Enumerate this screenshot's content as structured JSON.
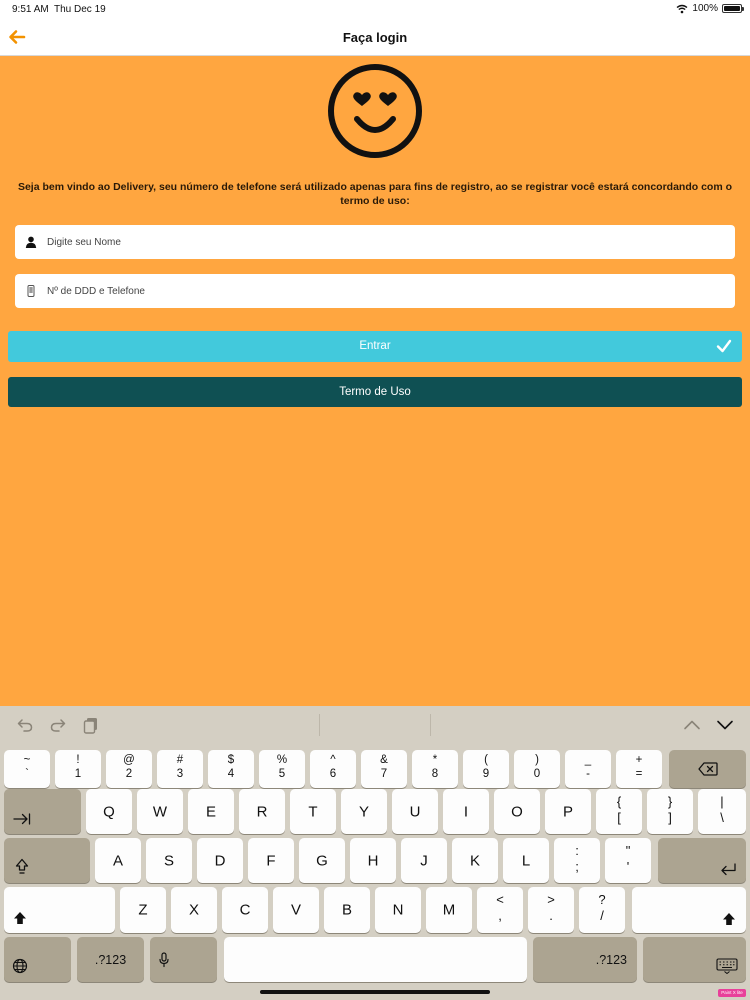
{
  "status_bar": {
    "time": "9:51 AM",
    "date": "Thu Dec 19",
    "battery": "100%"
  },
  "nav": {
    "title": "Faça login"
  },
  "welcome_text": "Seja bem vindo ao Delivery, seu número de telefone será utilizado apenas para fins de registro, ao se registrar você estará concordando com o termo de uso:",
  "form": {
    "name_placeholder": "Digite seu Nome",
    "phone_placeholder": "Nº de DDD e Telefone",
    "enter_label": "Entrar",
    "terms_label": "Termo de Uso"
  },
  "colors": {
    "background": "#ffa640",
    "enter_button": "#42c9dc",
    "terms_button": "#0f5053",
    "accent": "#f39200"
  },
  "keyboard": {
    "number_row": [
      {
        "top": "~",
        "bot": "`"
      },
      {
        "top": "!",
        "bot": "1"
      },
      {
        "top": "@",
        "bot": "2"
      },
      {
        "top": "#",
        "bot": "3"
      },
      {
        "top": "$",
        "bot": "4"
      },
      {
        "top": "%",
        "bot": "5"
      },
      {
        "top": "^",
        "bot": "6"
      },
      {
        "top": "&",
        "bot": "7"
      },
      {
        "top": "*",
        "bot": "8"
      },
      {
        "top": "(",
        "bot": "9"
      },
      {
        "top": ")",
        "bot": "0"
      },
      {
        "top": "_",
        "bot": "-"
      },
      {
        "top": "+",
        "bot": "="
      }
    ],
    "row_q": [
      "Q",
      "W",
      "E",
      "R",
      "T",
      "Y",
      "U",
      "I",
      "O",
      "P"
    ],
    "row_q_sym": [
      {
        "top": "{",
        "bot": "["
      },
      {
        "top": "}",
        "bot": "]"
      },
      {
        "top": "|",
        "bot": "\\"
      }
    ],
    "row_a": [
      "A",
      "S",
      "D",
      "F",
      "G",
      "H",
      "J",
      "K",
      "L"
    ],
    "row_a_sym": [
      {
        "top": ":",
        "bot": ";"
      },
      {
        "top": "\"",
        "bot": "'"
      }
    ],
    "row_z": [
      "Z",
      "X",
      "C",
      "V",
      "B",
      "N",
      "M"
    ],
    "row_z_sym": [
      {
        "top": "<",
        "bot": ","
      },
      {
        "top": ">",
        "bot": "."
      },
      {
        "top": "?",
        "bot": "/"
      }
    ],
    "numbers_label": ".?123"
  },
  "icons": {
    "back": "arrow-left-icon",
    "smiley": "heart-eyes-smiley-icon",
    "name_field": "user-icon",
    "phone_field": "phone-icon",
    "enter": "checkmark-icon",
    "undo": "undo-icon",
    "redo": "redo-icon",
    "paste": "paste-icon",
    "up": "chevron-up-icon",
    "down": "chevron-down-icon",
    "delete": "delete-icon",
    "tab": "tab-icon",
    "caps": "caps-lock-icon",
    "return": "return-icon",
    "shift": "shift-icon",
    "globe": "globe-icon",
    "mic": "microphone-icon",
    "dismiss": "keyboard-dismiss-icon"
  },
  "overlay_badge": "Paint X lite"
}
